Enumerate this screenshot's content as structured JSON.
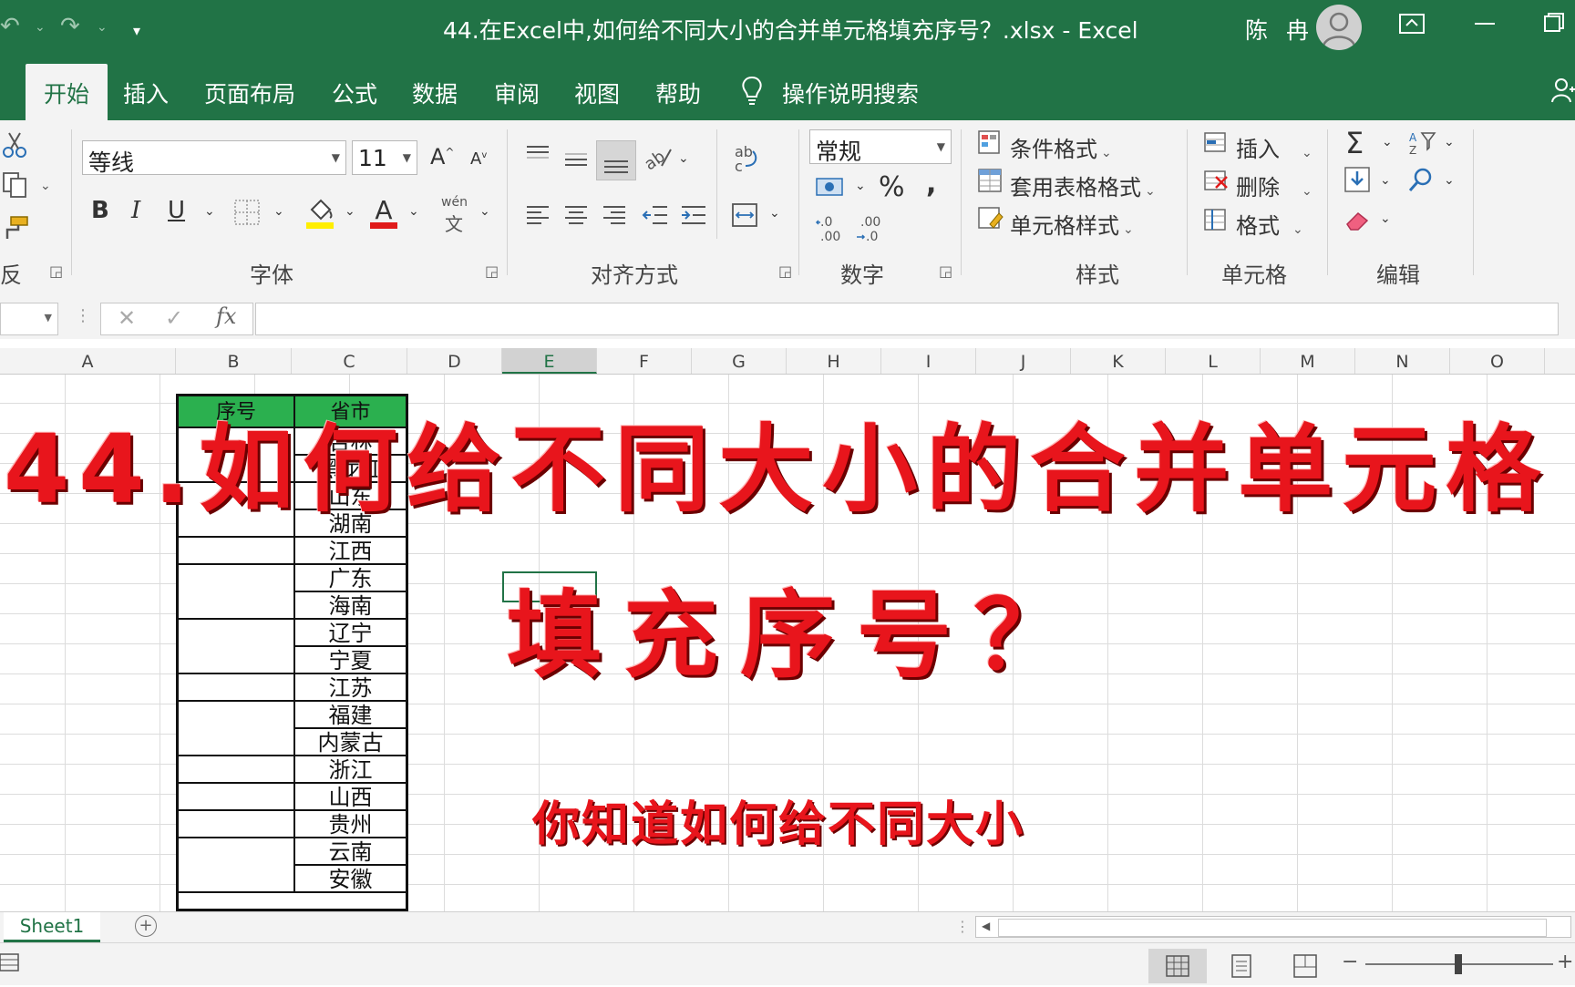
{
  "window": {
    "title": "44.在Excel中,如何给不同大小的合并单元格填充序号？.xlsx  -  Excel",
    "user": "陈 冉"
  },
  "tabs": [
    "开始",
    "插入",
    "页面布局",
    "公式",
    "数据",
    "审阅",
    "视图",
    "帮助"
  ],
  "tell_me": "操作说明搜索",
  "ribbon": {
    "clipboard_label_partial": "反",
    "font_name": "等线",
    "font_size": "11",
    "pinyin": "wén",
    "pinyin_char": "文",
    "font_group": "字体",
    "align_group": "对齐方式",
    "number_format": "常规",
    "number_group": "数字",
    "cond_format": "条件格式",
    "table_format": "套用表格格式",
    "cell_style": "单元格样式",
    "styles_group": "样式",
    "insert": "插入",
    "delete": "删除",
    "format": "格式",
    "cells_group": "单元格",
    "editing_group": "编辑",
    "bold": "B",
    "italic": "I",
    "underline": "U",
    "percent": "%",
    "comma": ",",
    "sigma": "Σ"
  },
  "columns": [
    "A",
    "B",
    "C",
    "D",
    "E",
    "F",
    "G",
    "H",
    "I",
    "J",
    "K",
    "L",
    "M",
    "N",
    "O"
  ],
  "selected_column": "E",
  "table": {
    "header_seq": "序号",
    "header_province": "省市",
    "provinces": [
      "吉林",
      "黑龙江",
      "山东",
      "湖南",
      "江西",
      "广东",
      "海南",
      "辽宁",
      "宁夏",
      "江苏",
      "福建",
      "内蒙古",
      "浙江",
      "山西",
      "贵州",
      "云南",
      "安徽"
    ]
  },
  "overlay": {
    "line1": "44.如何给不同大小的合并单元格",
    "line2": "填充序号？",
    "subtitle": "你知道如何给不同大小"
  },
  "sheet": {
    "tab": "Sheet1",
    "add": "+"
  },
  "colors": {
    "excel_green": "#217346",
    "header_green": "#2bb04f",
    "overlay_red": "#e8151c"
  }
}
